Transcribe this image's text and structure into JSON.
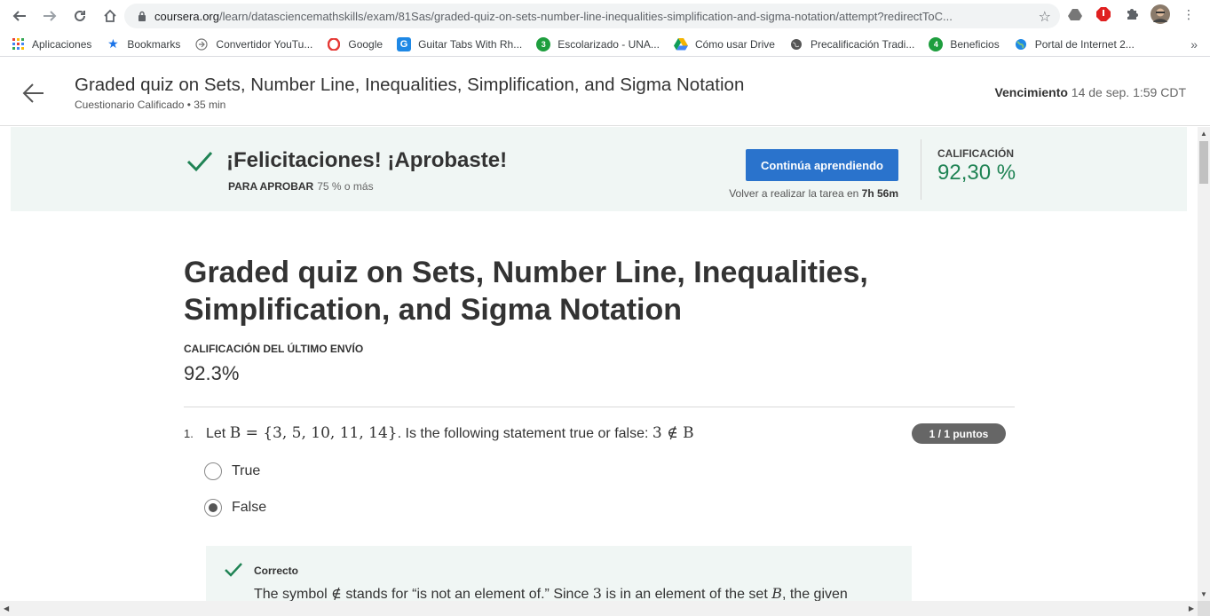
{
  "browser": {
    "url_main": "coursera.org",
    "url_rest": "/learn/datasciencemathskills/exam/81Sas/graded-quiz-on-sets-number-line-inequalities-simplification-and-sigma-notation/attempt?redirectToC...",
    "bookmarks": [
      {
        "label": "Aplicaciones",
        "icon": "apps-grid-icon",
        "color": "#4285f4"
      },
      {
        "label": "Bookmarks",
        "icon": "star-icon",
        "color": "#1a73e8"
      },
      {
        "label": "Convertidor YouTu...",
        "icon": "converter-icon",
        "color": "#5f6368"
      },
      {
        "label": "Google",
        "icon": "opera-icon",
        "color": "#e53935"
      },
      {
        "label": "Guitar Tabs With Rh...",
        "icon": "guitar-tabs-icon",
        "color": "#1e88e5"
      },
      {
        "label": "Escolarizado - UNA...",
        "icon": "una-icon",
        "color": "#1e9e3e"
      },
      {
        "label": "Cómo usar Drive",
        "icon": "drive-icon",
        "color": "#f4b400"
      },
      {
        "label": "Precalificación Tradi...",
        "icon": "globe-icon",
        "color": "#444"
      },
      {
        "label": "Beneficios",
        "icon": "beneficios-icon",
        "color": "#1e9e3e"
      },
      {
        "label": "Portal de Internet 2...",
        "icon": "portal-globe-icon",
        "color": "#1e88e5"
      }
    ]
  },
  "header": {
    "title": "Graded quiz on Sets, Number Line, Inequalities, Simplification, and Sigma Notation",
    "subtitle": "Cuestionario Calificado • 35 min",
    "due_label": "Vencimiento",
    "due_value": " 14 de sep. 1:59 CDT"
  },
  "banner": {
    "title": "¡Felicitaciones! ¡Aprobaste!",
    "pass_label": "PARA APROBAR",
    "pass_value": "75 % o más",
    "continue_label": "Continúa aprendiendo",
    "retry_prefix": "Volver a realizar la tarea en ",
    "retry_time": "7h 56m",
    "grade_label": "CALIFICACIÓN",
    "grade_value": "92,30 %"
  },
  "main": {
    "title": "Graded quiz on Sets, Number Line, Inequalities, Simplification, and Sigma Notation",
    "last_label": "CALIFICACIÓN DEL ÚLTIMO ENVÍO",
    "last_value": "92.3%"
  },
  "question": {
    "number": "1.",
    "text_prefix": "Let ",
    "math_set": "B = {3, 5, 10, 11, 14}",
    "text_mid": ". Is the following statement true or false: ",
    "math_statement": "3 ∉ B",
    "points": "1 / 1 puntos",
    "options": [
      {
        "label": "True",
        "checked": false
      },
      {
        "label": "False",
        "checked": true
      }
    ]
  },
  "feedback": {
    "title": "Correcto",
    "text_1": "The symbol ",
    "symbol": "∉",
    "text_2": " stands for “is not an element of.” Since ",
    "math_3": "3",
    "text_3": " is in an element of the set ",
    "math_b": "B",
    "text_4": ", the given"
  },
  "colors": {
    "accent_blue": "#2a73cc",
    "success_green": "#1f8354",
    "banner_bg": "#f0f6f4"
  }
}
